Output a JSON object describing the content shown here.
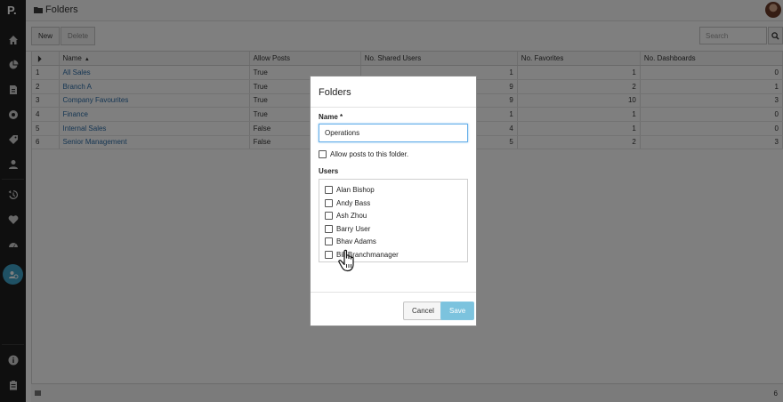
{
  "app": {
    "logo_text": "P.",
    "brand_color": "#3ea2c8"
  },
  "header": {
    "title": "Folders",
    "title_icon": "folder-icon"
  },
  "rail": {
    "items": [
      {
        "icon": "home-icon"
      },
      {
        "icon": "pie-chart-icon"
      },
      {
        "icon": "reports-icon"
      },
      {
        "icon": "discovery-icon"
      },
      {
        "icon": "tags-icon"
      },
      {
        "icon": "user-icon"
      },
      {
        "icon": "history-icon"
      },
      {
        "icon": "heart-icon"
      },
      {
        "icon": "dashboard-icon"
      },
      {
        "icon": "folder-admin-icon",
        "active": true
      },
      {
        "icon": "info-icon"
      },
      {
        "icon": "clipboard-icon"
      }
    ]
  },
  "toolbar": {
    "new_label": "New",
    "delete_label": "Delete",
    "search_placeholder": "Search"
  },
  "table": {
    "columns": [
      "",
      "Name",
      "Allow Posts",
      "No. Shared Users",
      "No. Favorites",
      "No. Dashboards"
    ],
    "sort_indicator": "▲",
    "rows": [
      {
        "idx": "1",
        "name": "All Sales",
        "allow": "True",
        "shared": "1",
        "fav": "1",
        "dash": "0"
      },
      {
        "idx": "2",
        "name": "Branch A",
        "allow": "True",
        "shared": "9",
        "fav": "2",
        "dash": "1"
      },
      {
        "idx": "3",
        "name": "Company Favourites",
        "allow": "True",
        "shared": "9",
        "fav": "10",
        "dash": "3"
      },
      {
        "idx": "4",
        "name": "Finance",
        "allow": "True",
        "shared": "1",
        "fav": "1",
        "dash": "0"
      },
      {
        "idx": "5",
        "name": "Internal Sales",
        "allow": "False",
        "shared": "4",
        "fav": "1",
        "dash": "0"
      },
      {
        "idx": "6",
        "name": "Senior Management",
        "allow": "False",
        "shared": "5",
        "fav": "2",
        "dash": "3"
      }
    ]
  },
  "footer": {
    "count": "6"
  },
  "modal": {
    "title": "Folders",
    "name_label": "Name *",
    "name_value": "Operations",
    "allow_label": "Allow posts to this folder.",
    "users_label": "Users",
    "users": [
      "Alan Bishop",
      "Andy Bass",
      "Ash Zhou",
      "Barry User",
      "Bhav Adams",
      "Bill Branchmanager"
    ],
    "cancel_label": "Cancel",
    "save_label": "Save"
  }
}
